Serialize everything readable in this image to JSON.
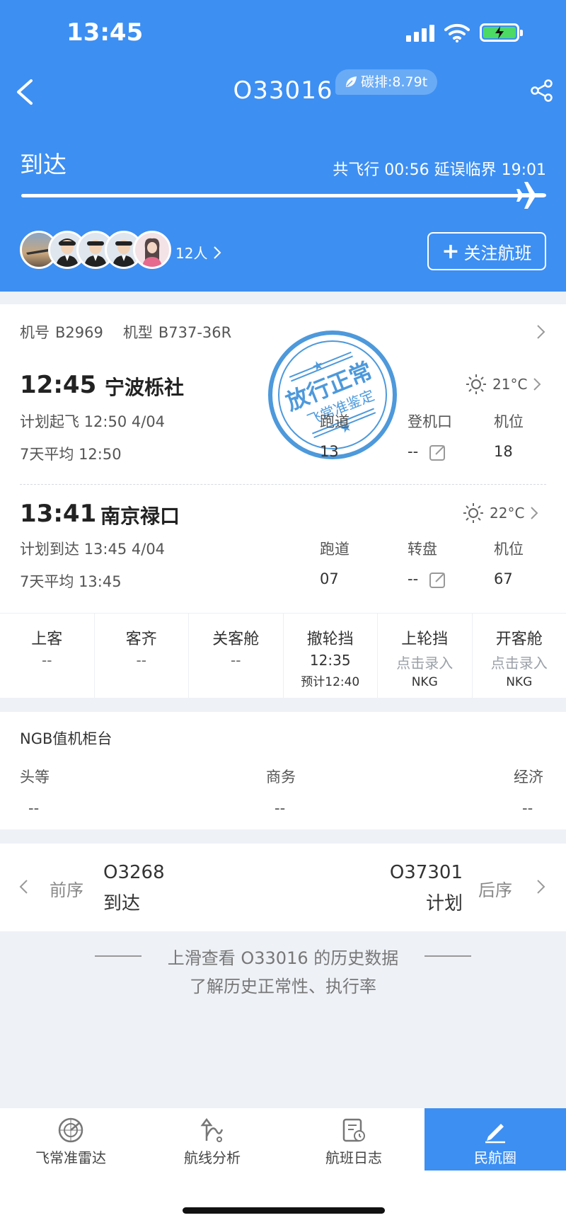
{
  "status_bar": {
    "time": "13:45"
  },
  "header": {
    "flight_no": "O33016",
    "carbon": "碳排:8.79t",
    "status": "到达",
    "flight_info": "共飞行 00:56 延误临界 19:01",
    "people_count": "12人",
    "follow_label": "关注航班",
    "follow_plus": "+"
  },
  "aircraft": {
    "reg_label": "机号",
    "reg": "B2969",
    "type_label": "机型",
    "type": "B737-36R"
  },
  "stamp": {
    "main": "放行正常",
    "sub": "飞常准鉴定",
    "star": "★"
  },
  "departure": {
    "time": "12:45",
    "airport": "宁波栎社",
    "temp": "21°C",
    "plan_label": "计划起飞",
    "plan": "12:50 4/04",
    "avg_label": "7天平均",
    "avg": "12:50",
    "runway_label": "跑道",
    "runway": "13",
    "gate_label": "登机口",
    "gate": "--",
    "stand_label": "机位",
    "stand": "18"
  },
  "arrival": {
    "time": "13:41",
    "airport": "南京禄口",
    "temp": "22°C",
    "plan_label": "计划到达",
    "plan": "13:45 4/04",
    "avg_label": "7天平均",
    "avg": "13:45",
    "runway_label": "跑道",
    "runway": "07",
    "carousel_label": "转盘",
    "carousel": "--",
    "stand_label": "机位",
    "stand": "67"
  },
  "steps": [
    {
      "title": "上客",
      "value": "--",
      "sub": ""
    },
    {
      "title": "客齐",
      "value": "--",
      "sub": ""
    },
    {
      "title": "关客舱",
      "value": "--",
      "sub": ""
    },
    {
      "title": "撤轮挡",
      "value": "12:35",
      "sub": "预计12:40"
    },
    {
      "title": "上轮挡",
      "value": "点击录入",
      "sub": "NKG"
    },
    {
      "title": "开客舱",
      "value": "点击录入",
      "sub": "NKG"
    }
  ],
  "checkin": {
    "title": "NGB值机柜台",
    "first_label": "头等",
    "first": "--",
    "business_label": "商务",
    "business": "--",
    "economy_label": "经济",
    "economy": "--"
  },
  "prev_next": {
    "prev_label": "前序",
    "prev_code": "O3268",
    "prev_status": "到达",
    "next_label": "后序",
    "next_code": "O37301",
    "next_status": "计划"
  },
  "hint": {
    "line1": "上滑查看 O33016 的历史数据",
    "line2": "了解历史正常性、执行率"
  },
  "tabs": [
    {
      "label": "飞常准雷达",
      "icon": "radar-icon"
    },
    {
      "label": "航线分析",
      "icon": "route-icon"
    },
    {
      "label": "航班日志",
      "icon": "log-icon"
    },
    {
      "label": "民航圈",
      "icon": "pen-icon"
    }
  ],
  "colors": {
    "primary": "#3d8ff2",
    "stamp": "#3a8fd8"
  }
}
